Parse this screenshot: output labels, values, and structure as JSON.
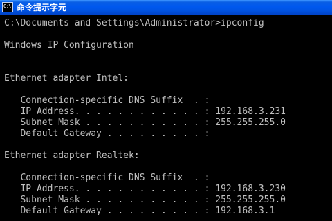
{
  "window": {
    "title": "命令提示字元",
    "icon_name": "console-icon",
    "icon_label": "C:\\"
  },
  "console": {
    "lines": [
      "C:\\Documents and Settings\\Administrator>ipconfig",
      "Windows IP Configuration",
      "Ethernet adapter Intel:",
      "   Connection-specific DNS Suffix  . :",
      "   IP Address. . . . . . . . . . . . : 192.168.3.231",
      "   Subnet Mask . . . . . . . . . . . : 255.255.255.0",
      "   Default Gateway . . . . . . . . . :",
      "Ethernet adapter Realtek:",
      "   Connection-specific DNS Suffix  . :",
      "   IP Address. . . . . . . . . . . . : 192.168.3.230",
      "   Subnet Mask . . . . . . . . . . . : 255.255.255.0",
      "   Default Gateway . . . . . . . . . : 192.168.3.1"
    ]
  },
  "colors": {
    "console_background": "#000000",
    "console_text": "#c0c0c0",
    "titlebar": "#0054e3",
    "title_text": "#ffffff"
  }
}
